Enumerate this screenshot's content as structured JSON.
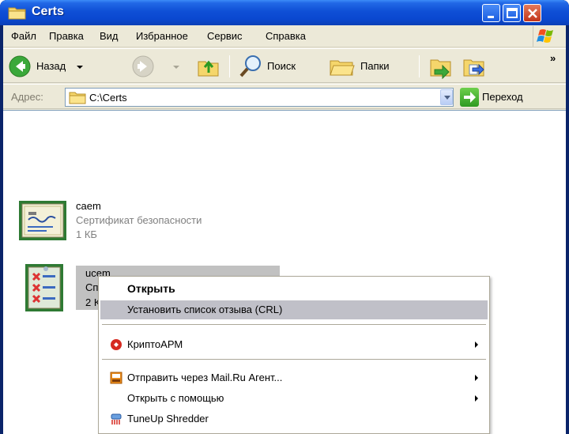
{
  "window": {
    "title": "Certs"
  },
  "menubar": {
    "items": [
      {
        "label": "Файл"
      },
      {
        "label": "Правка"
      },
      {
        "label": "Вид"
      },
      {
        "label": "Избранное"
      },
      {
        "label": "Сервис"
      },
      {
        "label": "Справка"
      }
    ]
  },
  "toolbar": {
    "back_label": "Назад",
    "search_label": "Поиск",
    "folders_label": "Папки",
    "more_glyph": "»"
  },
  "address": {
    "label": "Адрес:",
    "value": "C:\\Certs",
    "go_label": "Переход"
  },
  "files": [
    {
      "name": "caem",
      "type": "Сертификат безопасности",
      "size": "1 КБ",
      "icon": "certificate-icon"
    },
    {
      "name": "ucem",
      "type": "Список отзыва сертификатов",
      "size": "2 К",
      "icon": "crl-icon",
      "selected": true
    }
  ],
  "context_menu": {
    "items": [
      {
        "label": "Открыть",
        "bold": true
      },
      {
        "label": "Установить список отзыва (CRL)",
        "highlighted": true
      },
      {
        "label": "КриптоАРМ",
        "icon": "cryptoarm-icon",
        "submenu": true
      },
      {
        "label": "Отправить через Mail.Ru Агент...",
        "icon": "mailru-agent-icon",
        "submenu": true
      },
      {
        "label": "Открыть с помощью",
        "submenu": true
      },
      {
        "label": "TuneUp Shredder",
        "icon": "shredder-icon"
      }
    ]
  },
  "colors": {
    "titlebar": "#0a48d0",
    "chrome": "#ece9d8",
    "selection": "#c1c1c1",
    "menu_highlight": "#c0c0c8"
  }
}
